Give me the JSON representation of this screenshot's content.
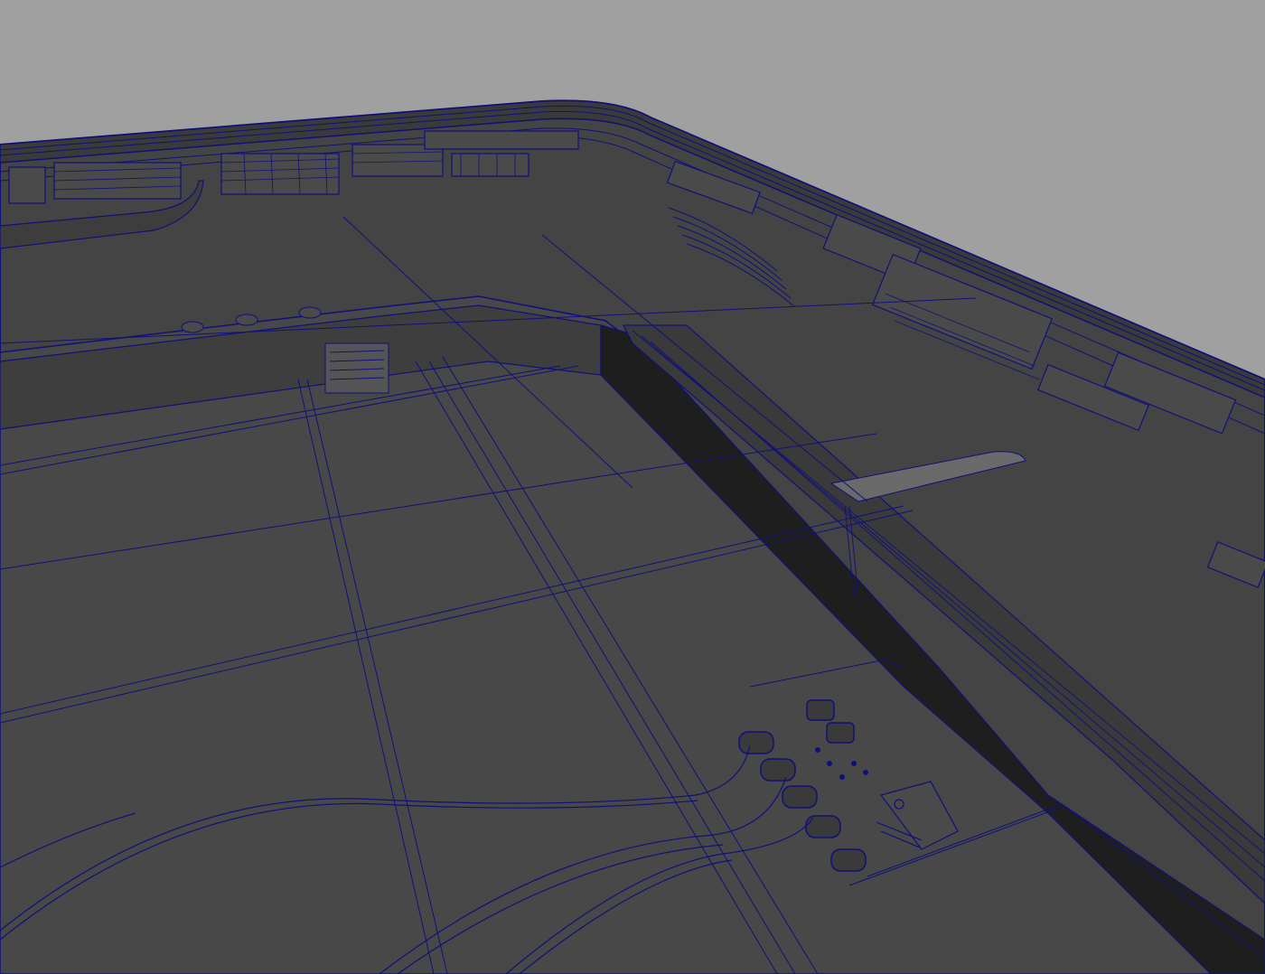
{
  "viewport": {
    "background_color": "#a0a0a0",
    "surface_color": "#444444",
    "surface_dark_color": "#2a2a2a",
    "wireframe_color": "#10107a"
  },
  "scene": {
    "description_icon": "wireframe-3d-model"
  }
}
